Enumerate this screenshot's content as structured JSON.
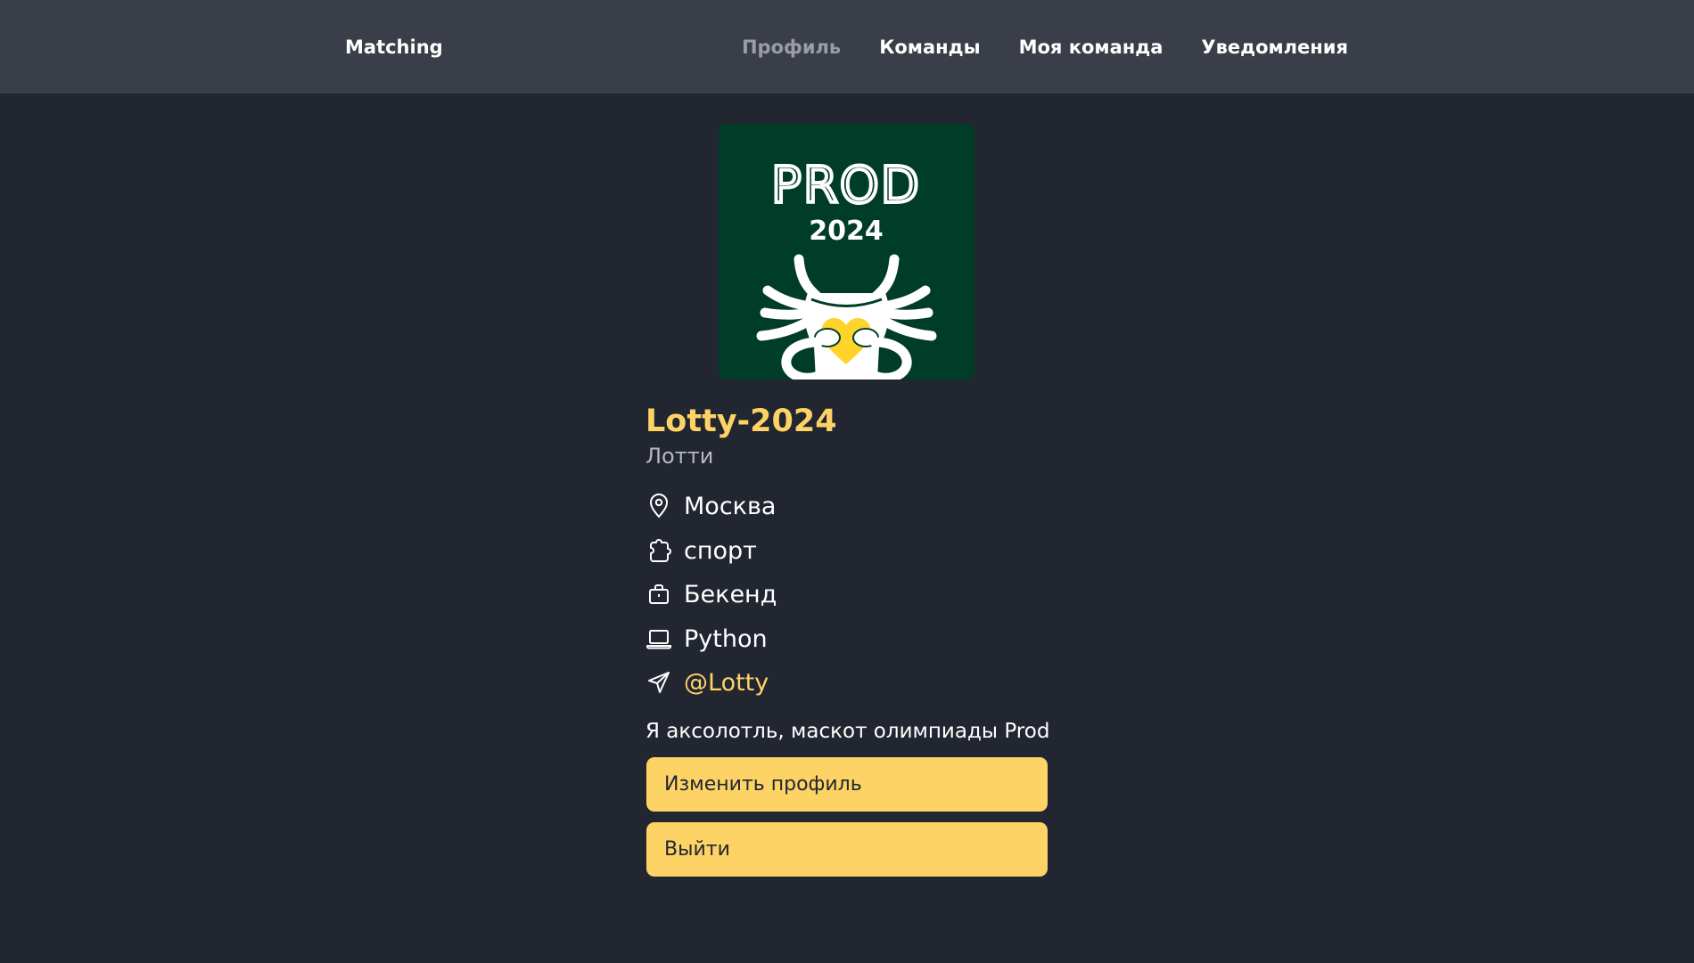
{
  "navbar": {
    "brand": "Matching",
    "links": [
      {
        "label": "Профиль",
        "active": true
      },
      {
        "label": "Команды",
        "active": false
      },
      {
        "label": "Моя команда",
        "active": false
      },
      {
        "label": "Уведомления",
        "active": false
      }
    ]
  },
  "profile": {
    "logo": {
      "text": "PROD",
      "year": "2024"
    },
    "username": "Lotty-2024",
    "name": "Лотти",
    "details": [
      {
        "icon": "location-pin-icon",
        "text": "Москва"
      },
      {
        "icon": "puzzle-piece-icon",
        "text": "спорт"
      },
      {
        "icon": "briefcase-icon",
        "text": "Бекенд"
      },
      {
        "icon": "laptop-icon",
        "text": "Python"
      },
      {
        "icon": "telegram-send-icon",
        "text": "@Lotty"
      }
    ],
    "bio": "Я аксолотль, маскот олимпиады Prod"
  },
  "actions": {
    "edit_label": "Изменить профиль",
    "logout_label": "Выйти"
  },
  "colors": {
    "background": "#212631",
    "navbar": "#393e48",
    "accent": "#fdd366",
    "logo_bg": "#003d28"
  }
}
